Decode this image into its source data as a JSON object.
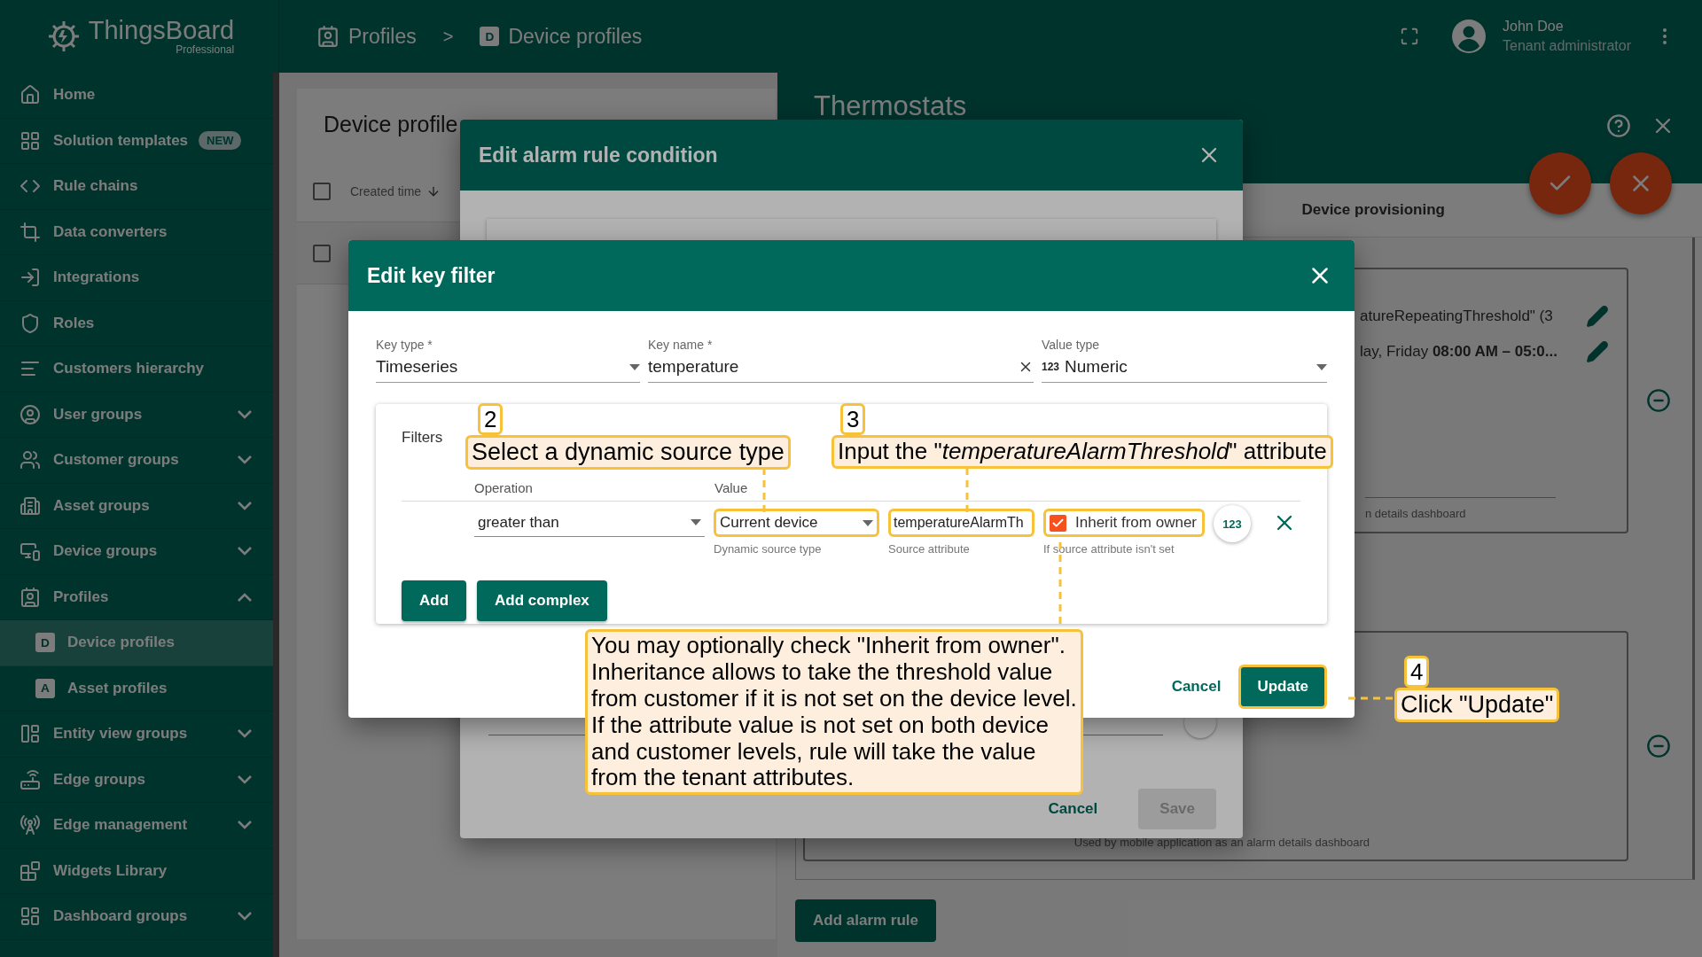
{
  "header": {
    "logo_name": "ThingsBoard",
    "logo_edition": "Professional",
    "breadcrumbs": [
      {
        "label": "Profiles"
      },
      {
        "label": "Device profiles",
        "badge": "D"
      }
    ],
    "separator": ">",
    "user": {
      "name": "John Doe",
      "role": "Tenant administrator"
    }
  },
  "sidebar": {
    "items": [
      {
        "label": "Home",
        "kind": "link",
        "selected": false
      },
      {
        "label": "Solution templates",
        "kind": "link",
        "selected": false,
        "badge": "NEW"
      },
      {
        "label": "Rule chains",
        "kind": "link",
        "selected": false
      },
      {
        "label": "Data converters",
        "kind": "link",
        "selected": false
      },
      {
        "label": "Integrations",
        "kind": "link",
        "selected": false
      },
      {
        "label": "Roles",
        "kind": "link",
        "selected": false
      },
      {
        "label": "Customers hierarchy",
        "kind": "link",
        "selected": false
      },
      {
        "label": "User groups",
        "kind": "group",
        "expanded": false,
        "selected": false
      },
      {
        "label": "Customer groups",
        "kind": "group",
        "expanded": false,
        "selected": false
      },
      {
        "label": "Asset groups",
        "kind": "group",
        "expanded": false,
        "selected": false
      },
      {
        "label": "Device groups",
        "kind": "group",
        "expanded": false,
        "selected": false
      },
      {
        "label": "Profiles",
        "kind": "group",
        "expanded": true,
        "selected": false,
        "children": [
          {
            "label": "Device profiles",
            "badge": "D",
            "selected": true
          },
          {
            "label": "Asset profiles",
            "badge": "A",
            "selected": false
          }
        ]
      },
      {
        "label": "Entity view groups",
        "kind": "group",
        "expanded": false,
        "selected": false
      },
      {
        "label": "Edge groups",
        "kind": "group",
        "expanded": false,
        "selected": false
      },
      {
        "label": "Edge management",
        "kind": "group",
        "expanded": false,
        "selected": false
      },
      {
        "label": "Widgets Library",
        "kind": "link",
        "selected": false
      },
      {
        "label": "Dashboard groups",
        "kind": "group",
        "expanded": false,
        "selected": false
      }
    ]
  },
  "profile_list": {
    "title": "Device profile",
    "column": "Created time",
    "header_checked": false,
    "rows": [
      {
        "checked": false
      }
    ]
  },
  "profile_details": {
    "title": "Thermostats",
    "tab": "Device provisioning",
    "cards": [
      {
        "lines": [
          "atureRepeatingThreshold\" (3",
          "lay, Friday **08:00 AM – 05:0...**"
        ],
        "hint": "n details dashboard"
      },
      {
        "hint": "Used by mobile application as an alarm details dashboard"
      }
    ],
    "add_button": "Add alarm rule"
  },
  "alarm_dialog": {
    "title": "Edit alarm rule condition",
    "cancel": "Cancel",
    "save": {
      "label": "Save",
      "disabled": true
    }
  },
  "key_filter_dialog": {
    "title": "Edit key filter",
    "fields": [
      {
        "kind": "select",
        "label": "Key type *",
        "value": "Timeseries"
      },
      {
        "kind": "text",
        "label": "Key name *",
        "value": "temperature"
      },
      {
        "kind": "select",
        "label": "Value type",
        "value": "Numeric",
        "prefix": "123"
      }
    ],
    "filters": {
      "label": "Filters",
      "columns": [
        "Operation",
        "Value"
      ],
      "operation": "greater than",
      "source_type": {
        "value": "Current device",
        "helper": "Dynamic source type",
        "highlighted": true
      },
      "source_attribute": {
        "value": "temperatureAlarmTh",
        "helper": "Source attribute",
        "highlighted": true
      },
      "inherit": {
        "label": "Inherit from owner",
        "helper": "If source attribute isn't set",
        "checked": true,
        "highlighted": true
      },
      "type_button": "123",
      "buttons": [
        "Add",
        "Add complex"
      ]
    },
    "cancel": "Cancel",
    "update": {
      "label": "Update",
      "highlighted": true
    }
  },
  "callouts": [
    {
      "number": "2",
      "text": "Select a dynamic source type"
    },
    {
      "number": "3",
      "text": "Input the \"*temperatureAlarmThreshold*\" attribute"
    },
    {
      "lines": [
        "You may optionally check \"Inherit from owner\".",
        "Inheritance allows to take the threshold value",
        "from customer if it is not set on the device level.",
        "If the attribute value is not set on both device",
        "and customer levels, rule will take the value",
        "from the tenant attributes."
      ]
    },
    {
      "number": "4",
      "text": "Click \"Update\""
    }
  ]
}
